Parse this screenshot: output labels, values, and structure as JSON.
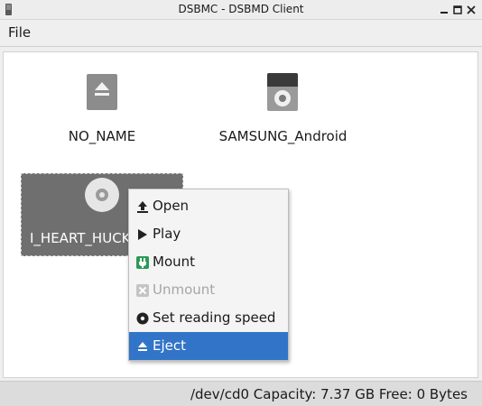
{
  "window": {
    "title": "DSBMC - DSBMD Client"
  },
  "menubar": {
    "file": "File"
  },
  "drives": [
    {
      "label": "NO_NAME",
      "icon": "removable-drive-icon"
    },
    {
      "label": "SAMSUNG_Android",
      "icon": "media-player-icon"
    },
    {
      "label": "I_HEART_HUCK",
      "icon": "optical-disc-icon",
      "selected": true
    }
  ],
  "context_menu": {
    "items": [
      {
        "label": "Open",
        "icon": "upload-arrow-icon",
        "enabled": true
      },
      {
        "label": "Play",
        "icon": "play-icon",
        "enabled": true
      },
      {
        "label": "Mount",
        "icon": "mount-plug-icon",
        "enabled": true
      },
      {
        "label": "Unmount",
        "icon": "unmount-icon",
        "enabled": false
      },
      {
        "label": "Set reading speed",
        "icon": "disc-speed-icon",
        "enabled": true
      },
      {
        "label": "Eject",
        "icon": "eject-icon",
        "enabled": true,
        "highlighted": true
      }
    ]
  },
  "status": {
    "text": "/dev/cd0 Capacity: 7.37 GB Free: 0 Bytes"
  },
  "colors": {
    "highlight": "#3274c8",
    "selected_tile": "#6f6f6f",
    "mount_green": "#2a9a55"
  }
}
